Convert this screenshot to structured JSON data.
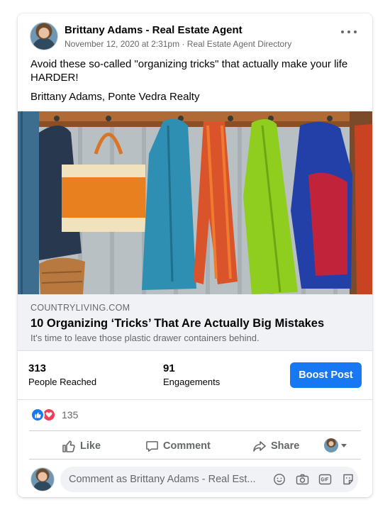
{
  "post": {
    "author": "Brittany Adams - Real Estate Agent",
    "date": "November 12, 2020 at 2:31pm",
    "separator": "·",
    "source": "Real Estate Agent Directory",
    "text_line1": "Avoid these so-called \"organizing tricks\" that actually make your life HARDER!",
    "text_line2": "Brittany Adams, Ponte Vedra Realty"
  },
  "link_preview": {
    "domain": "COUNTRYLIVING.COM",
    "title": "10 Organizing ‘Tricks’ That Are Actually Big Mistakes",
    "description": "It's time to leave those plastic drawer containers behind."
  },
  "insights": {
    "reached_value": "313",
    "reached_label": "People Reached",
    "engagements_value": "91",
    "engagements_label": "Engagements",
    "boost_label": "Boost Post"
  },
  "reactions": {
    "count": "135",
    "icons": [
      "like-icon",
      "love-icon"
    ]
  },
  "actions": {
    "like": "Like",
    "comment": "Comment",
    "share": "Share"
  },
  "comment": {
    "placeholder": "Comment as Brittany Adams - Real Est..."
  },
  "colors": {
    "accent": "#1877f2",
    "love": "#f33e58",
    "muted_text": "#65676b",
    "link_bg": "#f0f2f5"
  }
}
